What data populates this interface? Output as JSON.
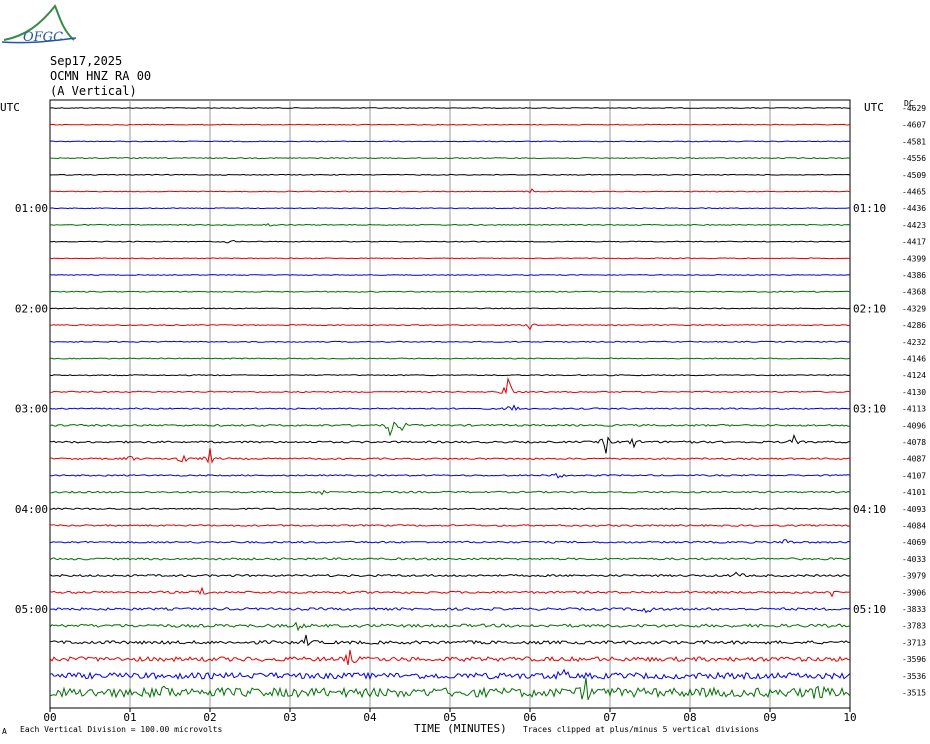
{
  "logo_text": "OFGC",
  "header": {
    "date": "Sep17,2025",
    "station": "OCMN HNZ RA 00",
    "component": "(A Vertical)"
  },
  "axis": {
    "left_utc": "UTC",
    "right_utc": "UTC",
    "dc_label": "DC",
    "xlabel": "TIME (MINUTES)"
  },
  "footer": {
    "left_marker": "A",
    "scale_note": "Each Vertical Division =  100.00 microvolts",
    "clip_note": "Traces clipped at plus/minus 5 vertical divisions"
  },
  "chart_data": {
    "type": "line",
    "subtype": "helicorder",
    "xlim": [
      0,
      10
    ],
    "xticks": [
      "00",
      "01",
      "02",
      "03",
      "04",
      "05",
      "06",
      "07",
      "08",
      "09",
      "10"
    ],
    "grid": true,
    "trace_colors": [
      "#000000",
      "#e00000",
      "#0000e0",
      "#007000"
    ],
    "row_count": 36,
    "left_hour_labels": [
      {
        "row": 6,
        "label": "01:00"
      },
      {
        "row": 12,
        "label": "02:00"
      },
      {
        "row": 18,
        "label": "03:00"
      },
      {
        "row": 24,
        "label": "04:00"
      },
      {
        "row": 30,
        "label": "05:00"
      }
    ],
    "right_time_labels": [
      {
        "row": 6,
        "label": "01:10"
      },
      {
        "row": 12,
        "label": "02:10"
      },
      {
        "row": 18,
        "label": "03:10"
      },
      {
        "row": 24,
        "label": "04:10"
      },
      {
        "row": 30,
        "label": "05:10"
      }
    ],
    "dc_offsets": [
      "-4629",
      "-4607",
      "-4581",
      "-4556",
      "-4509",
      "-4465",
      "-4436",
      "-4423",
      "-4417",
      "-4399",
      "-4386",
      "-4368",
      "-4329",
      "-4286",
      "-4232",
      "-4146",
      "-4124",
      "-4130",
      "-4113",
      "-4096",
      "-4078",
      "-4087",
      "-4107",
      "-4101",
      "-4093",
      "-4084",
      "-4069",
      "-4033",
      "-3979",
      "-3906",
      "-3833",
      "-3783",
      "-3713",
      "-3596",
      "-3536",
      "-3515"
    ],
    "noise_levels": [
      0.4,
      0.4,
      0.4,
      0.5,
      0.4,
      0.4,
      0.4,
      0.5,
      0.4,
      0.4,
      0.4,
      0.5,
      0.4,
      0.5,
      0.5,
      0.5,
      0.5,
      0.6,
      0.7,
      0.9,
      0.9,
      0.8,
      0.7,
      0.8,
      0.7,
      0.8,
      0.9,
      1.0,
      1.0,
      1.1,
      1.2,
      1.5,
      1.6,
      2.2,
      3.0,
      4.5
    ],
    "events": [
      {
        "row": 5,
        "minute": 6.03,
        "amplitude": 3
      },
      {
        "row": 7,
        "minute": 2.75,
        "amplitude": 3
      },
      {
        "row": 8,
        "minute": 2.25,
        "amplitude": 3
      },
      {
        "row": 13,
        "minute": 6.0,
        "amplitude": 4
      },
      {
        "row": 17,
        "minute": 5.72,
        "amplitude": 20
      },
      {
        "row": 18,
        "minute": 5.78,
        "amplitude": 8
      },
      {
        "row": 19,
        "minute": 4.25,
        "amplitude": 10
      },
      {
        "row": 19,
        "minute": 4.4,
        "amplitude": 5
      },
      {
        "row": 20,
        "minute": 6.95,
        "amplitude": 11
      },
      {
        "row": 20,
        "minute": 7.3,
        "amplitude": 7
      },
      {
        "row": 20,
        "minute": 7.95,
        "amplitude": 9
      },
      {
        "row": 20,
        "minute": 9.3,
        "amplitude": 6
      },
      {
        "row": 21,
        "minute": 1.65,
        "amplitude": 12
      },
      {
        "row": 21,
        "minute": 2.0,
        "amplitude": 10
      },
      {
        "row": 21,
        "minute": 1.0,
        "amplitude": 4
      },
      {
        "row": 22,
        "minute": 6.35,
        "amplitude": 5
      },
      {
        "row": 23,
        "minute": 3.4,
        "amplitude": 4
      },
      {
        "row": 26,
        "minute": 9.2,
        "amplitude": 5
      },
      {
        "row": 28,
        "minute": 8.6,
        "amplitude": 6
      },
      {
        "row": 29,
        "minute": 1.9,
        "amplitude": 6
      },
      {
        "row": 29,
        "minute": 9.8,
        "amplitude": 7
      },
      {
        "row": 30,
        "minute": 7.45,
        "amplitude": 13
      },
      {
        "row": 31,
        "minute": 3.1,
        "amplitude": 5
      },
      {
        "row": 32,
        "minute": 3.2,
        "amplitude": 6
      },
      {
        "row": 33,
        "minute": 3.75,
        "amplitude": 8
      },
      {
        "row": 34,
        "minute": 6.4,
        "amplitude": 7
      },
      {
        "row": 35,
        "minute": 6.7,
        "amplitude": 12
      },
      {
        "row": 35,
        "minute": 1.4,
        "amplitude": 10
      },
      {
        "row": 35,
        "minute": 9.6,
        "amplitude": 10
      }
    ]
  }
}
